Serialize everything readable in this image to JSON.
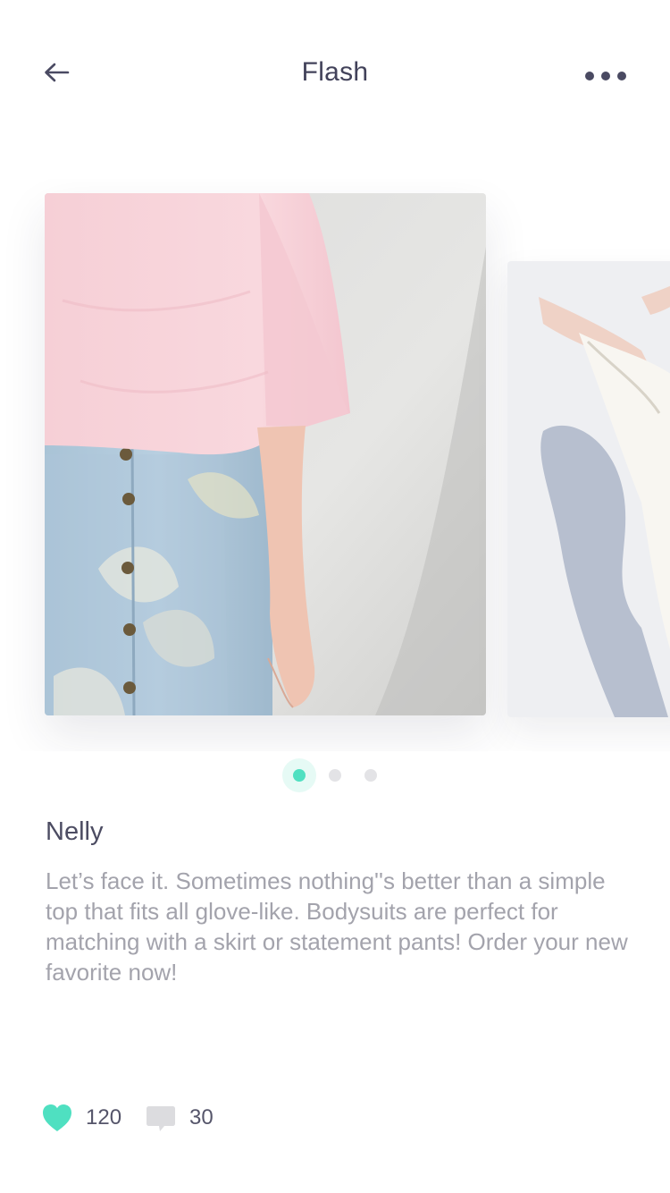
{
  "header": {
    "title": "Flash",
    "back_icon": "arrow-left-icon",
    "more_icon": "more-horizontal-icon"
  },
  "carousel": {
    "slides": [
      {
        "alt": "pink-tee-denim-skirt-photo"
      },
      {
        "alt": "white-top-photo"
      },
      {
        "alt": "third-photo"
      }
    ],
    "active_index": 0,
    "total": 3
  },
  "post": {
    "author": "Nelly",
    "description": "Let’s face it. Sometimes nothing''s better than a simple top that fits all glove-like. Bodysuits are perfect for matching with a skirt or statement pants! Order your new favorite now!"
  },
  "stats": {
    "likes": "120",
    "comments": "30",
    "like_icon": "heart-icon",
    "comment_icon": "comment-icon"
  },
  "colors": {
    "accent": "#4fe0c1",
    "text_primary": "#4a4a5c",
    "text_secondary": "#a3a3ac",
    "dot_inactive": "#e3e3e6"
  }
}
